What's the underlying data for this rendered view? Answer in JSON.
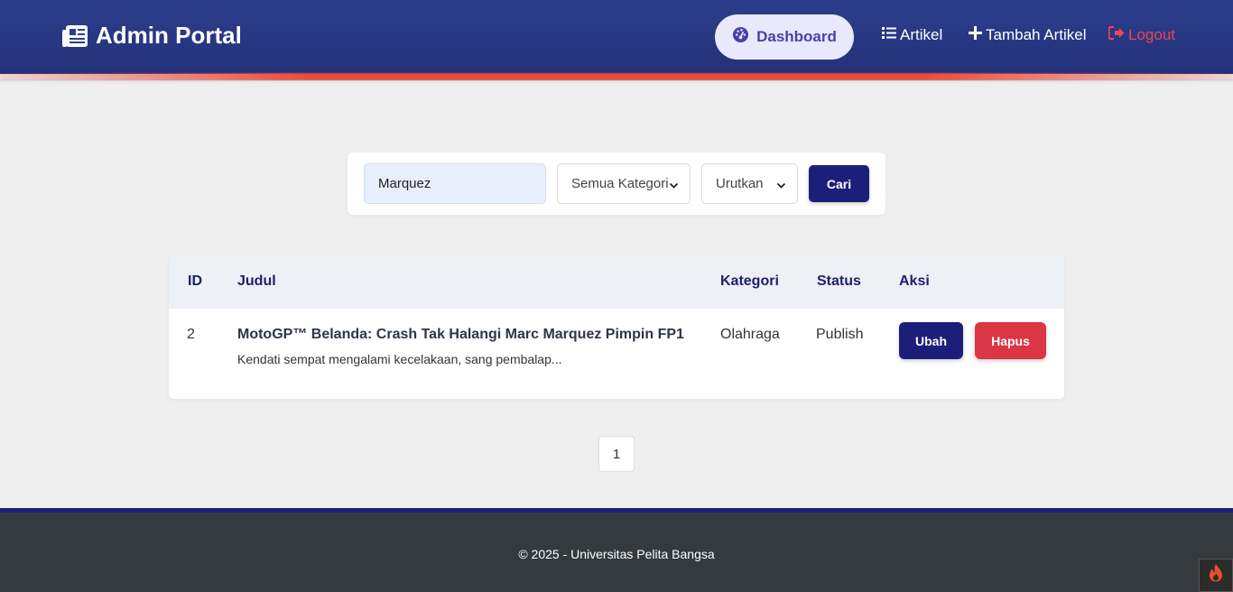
{
  "header": {
    "brand": "Admin Portal",
    "nav": {
      "dashboard": "Dashboard",
      "artikel": "Artikel",
      "tambah": "Tambah Artikel",
      "logout": "Logout"
    }
  },
  "search": {
    "query": "Marquez",
    "kategori_selected": "Semua Kategori",
    "urutkan_selected": "Urutkan",
    "submit_label": "Cari"
  },
  "table": {
    "headers": {
      "id": "ID",
      "judul": "Judul",
      "kategori": "Kategori",
      "status": "Status",
      "aksi": "Aksi"
    },
    "rows": [
      {
        "id": "2",
        "title": "MotoGP™ Belanda: Crash Tak Halangi Marc Marquez Pimpin FP1",
        "excerpt": "Kendati sempat mengalami kecelakaan, sang pembalap...",
        "kategori": "Olahraga",
        "status": "Publish",
        "edit_label": "Ubah",
        "delete_label": "Hapus"
      }
    ]
  },
  "pagination": {
    "current": "1"
  },
  "footer": {
    "text": "© 2025 - Universitas Pelita Bangsa"
  },
  "colors": {
    "header_bg": "#2c3f8c",
    "accent_red": "#e74c3c",
    "primary_button": "#1c1f7a",
    "danger_button": "#dc3545",
    "logout_text": "#f0445a",
    "footer_bg": "#343a40"
  },
  "icons": {
    "brand": "newspaper-icon",
    "dashboard": "gauge-icon",
    "artikel": "list-icon",
    "tambah": "plus-icon",
    "logout": "sign-out-icon",
    "toolbar": "flame-icon"
  }
}
